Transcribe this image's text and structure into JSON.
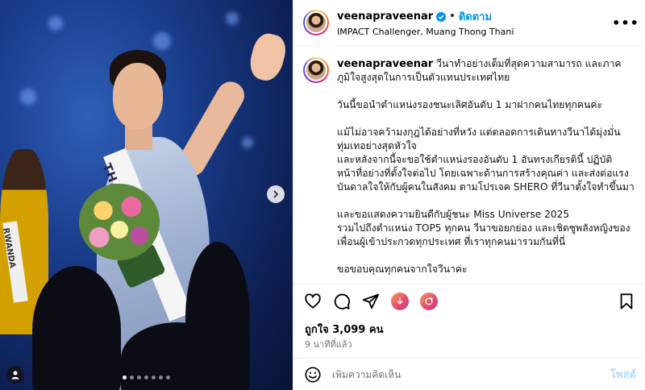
{
  "media": {
    "sash_text": "THAILAND",
    "left_sash_text": "RWANDA",
    "carousel": {
      "total_slides": 7,
      "active_index": 0
    }
  },
  "header": {
    "username": "veenapraveenar",
    "separator": "•",
    "follow_label": "ติดตาม",
    "location": "IMPACT Challenger, Muang Thong Thani",
    "more_label": "•••"
  },
  "caption": {
    "username": "veenapraveenar",
    "paragraphs": [
      "วีนาทำอย่างเต็มที่สุดความสามารถ และภาคภูมิใจสูงสุดในการเป็นตัวแทนประเทศไทย",
      "วันนี้ขอนำตำแหน่งรองชนะเลิศอันดับ 1 มาฝากคนไทยทุกคนค่ะ",
      "แม้ไม่อาจคว้ามงกุฎได้อย่างที่หวัง แต่ตลอดการเดินทางวีนาได้มุ่งมั่นทุ่มเทอย่างสุดหัวใจ\nและหลังจากนี้จะขอใช้ตำแหน่งรองอันดับ 1 อันทรงเกียรตินี้ ปฏิบัติหน้าที่อย่างที่ตั้งใจต่อไป โดยเฉพาะด้านการสร้างคุณค่า และส่งต่อแรงบันดาลใจให้กับผู้คนในสังคม ตามโปรเจค SHERO ที่วีนาตั้งใจทำขึ้นมา",
      "และขอแสดงความยินดีกับผู้ชนะ Miss Universe 2025\nรวมไปถึงตำแหน่ง TOP5 ทุกคน วีนาขอยกย่อง และเชิดชูพลังหญิงของเพื่อนผู้เข้าประกวดทุกประเทศ ที่เราทุกคนมารวมกันที่นี่",
      "ขอขอบคุณทุกคนจากใจวีนาค่ะ"
    ]
  },
  "stats": {
    "likes": "ถูกใจ 3,099 คน",
    "time": "9 นาทีที่แล้ว"
  },
  "comment_bar": {
    "placeholder": "เพิ่มความคิดเห็น",
    "post_label": "โพสต์"
  },
  "colors": {
    "follow": "#0095f6",
    "post_disabled": "#b3dbff",
    "muted": "#737373"
  },
  "icons": [
    "verified-badge-icon",
    "more-icon",
    "heart-icon",
    "comment-icon",
    "share-icon",
    "boost-icon",
    "reshare-icon",
    "bookmark-icon",
    "emoji-icon",
    "chevron-right-icon",
    "user-tag-icon"
  ]
}
